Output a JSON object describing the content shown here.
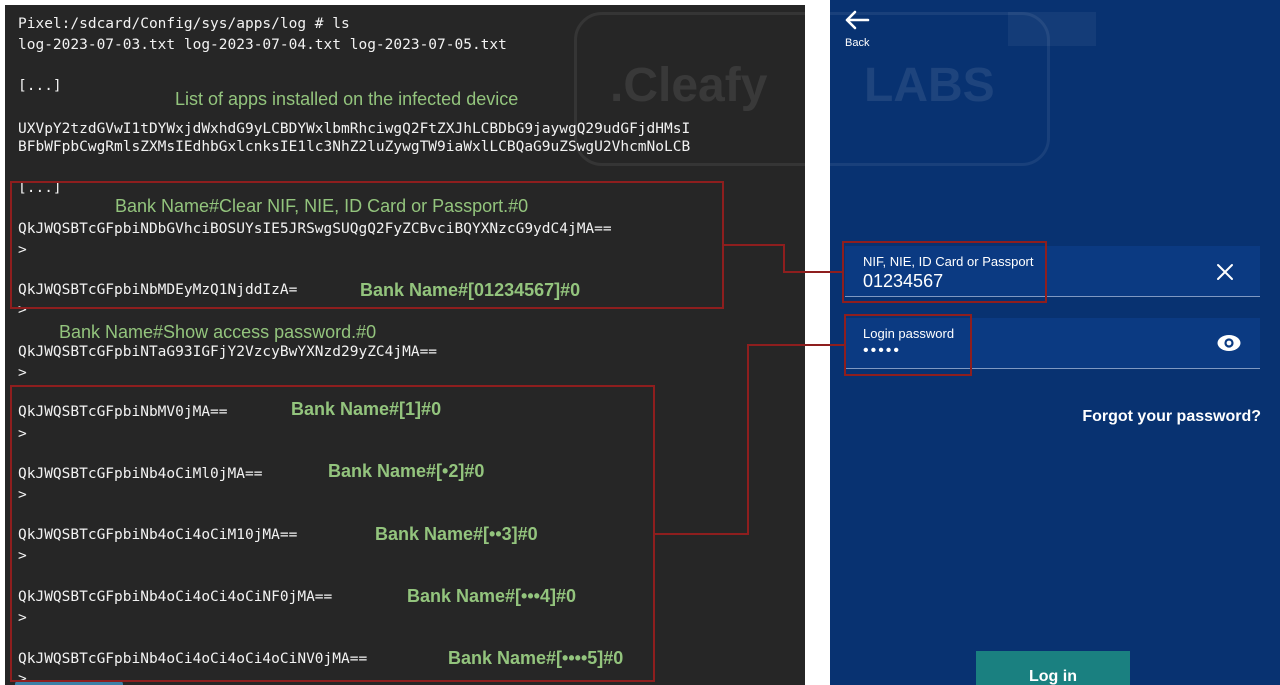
{
  "terminal": {
    "prompt_line": "Pixel:/sdcard/Config/sys/apps/log # ls",
    "ls_output": "log-2023-07-03.txt log-2023-07-04.txt log-2023-07-05.txt",
    "ellipsis_1": "[...]",
    "apps_line_1": "UXVpY2tzdGVwI1tDYWxjdWxhdG9yLCBDYWxlbmRhciwgQ2FtZXJhLCBDbG9jaywgQ29udGFjdHMsI",
    "apps_line_2": "BFbWFpbCwgRmlsZXMsIEdhbGxlcnksIE1lc3NhZ2luZywgTW9iaWxlLCBQaG9uZSwgU2VhcmNoLCB",
    "ellipsis_2": "[...]",
    "entries": [
      {
        "code": "QkJWQSBTcGFpbiNDbGVhciBOSUYsIE5JRSwgSUQgQ2FyZCBvciBQYXNzcG9ydC4jMA==",
        "prompt": ">"
      },
      {
        "code": "QkJWQSBTcGFpbiNbMDEyMzQ1NjddIzA=",
        "prompt": ">"
      },
      {
        "code": "QkJWQSBTcGFpbiNTaG93IGFjY2VzcyBwYXNzd29yZC4jMA==",
        "prompt": ">"
      },
      {
        "code": "QkJWQSBTcGFpbiNbMV0jMA==",
        "prompt": ">"
      },
      {
        "code": "QkJWQSBTcGFpbiNb4oCiMl0jMA==",
        "prompt": ">"
      },
      {
        "code": "QkJWQSBTcGFpbiNb4oCi4oCiM10jMA==",
        "prompt": ">"
      },
      {
        "code": "QkJWQSBTcGFpbiNb4oCi4oCi4oCiNF0jMA==",
        "prompt": ">"
      },
      {
        "code": "QkJWQSBTcGFpbiNb4oCi4oCi4oCi4oCiNV0jMA==",
        "prompt": ">"
      }
    ],
    "annotations": {
      "apps_caption": "List of apps installed on the infected device",
      "clear_caption": "Bank Name#Clear NIF, NIE, ID Card or Passport.#0",
      "id_decoded": "Bank Name#[01234567]#0",
      "show_caption": "Bank Name#Show access password.#0",
      "p1": "Bank Name#[1]#0",
      "p2": "Bank Name#[•2]#0",
      "p3": "Bank Name#[••3]#0",
      "p4": "Bank Name#[•••4]#0",
      "p5": "Bank Name#[••••5]#0"
    }
  },
  "watermark": {
    "brand": ".Cleafy",
    "labs": "LABS"
  },
  "phone": {
    "back_label": "Back",
    "id_field": {
      "label": "NIF, NIE, ID Card or Passport",
      "value": "01234567"
    },
    "password_field": {
      "label": "Login password",
      "value": "•••••"
    },
    "forgot_link": "Forgot your password?",
    "login_button": "Log in"
  },
  "colors": {
    "terminal_bg": "#262626",
    "phone_bg": "#083271",
    "annotation_green": "#93c47d",
    "highlight_red": "#8e1e1e",
    "login_button": "#1a8080"
  },
  "icons": [
    "back-arrow-icon",
    "clear-x-icon",
    "eye-icon"
  ]
}
